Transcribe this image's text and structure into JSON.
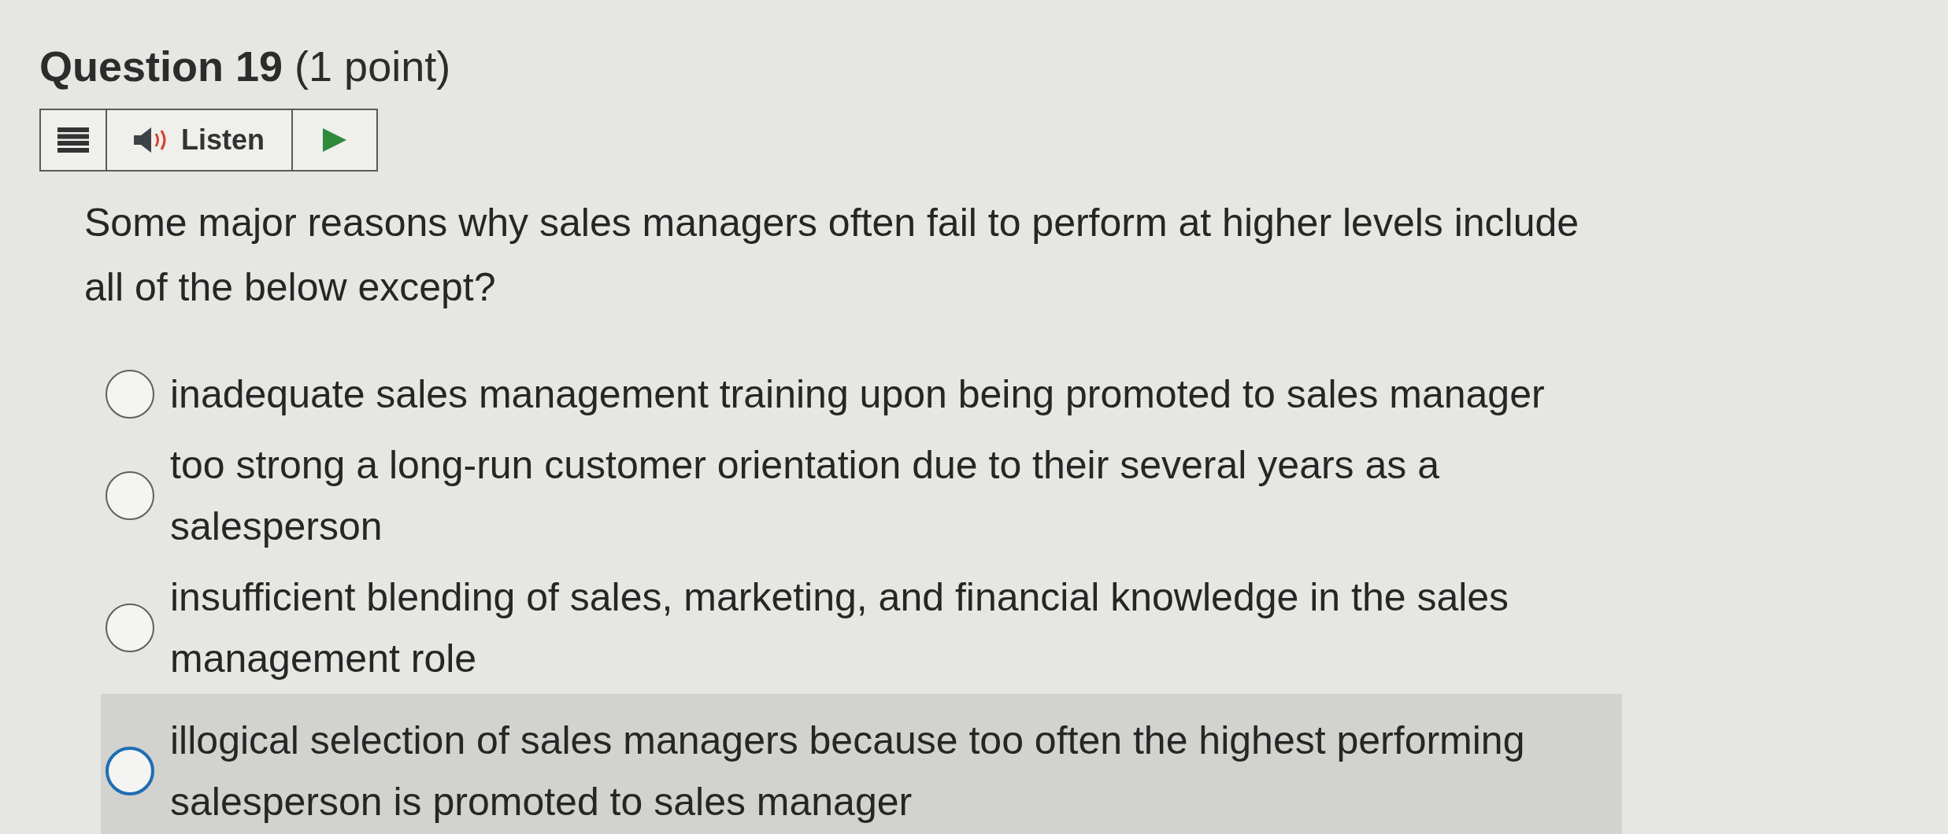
{
  "question": {
    "title": "**Question 19** (1 point)",
    "text": "Some major reasons why sales managers often fail to perform at higher levels include all of the below except?"
  },
  "toolbar": {
    "buttons": [
      {
        "kind": "menu"
      },
      {
        "kind": "listen",
        "label": "Listen"
      },
      {
        "kind": "play"
      }
    ]
  },
  "options": [
    {
      "label": "inadequate sales management training upon being promoted to sales manager",
      "selected": false,
      "highlighted": false
    },
    {
      "label": "too strong a long-run customer orientation due to their several years as a salesperson",
      "selected": false,
      "highlighted": false
    },
    {
      "label": "insufficient blending of sales, marketing, and financial knowledge in the sales management role",
      "selected": false,
      "highlighted": false
    },
    {
      "label": "illogical selection of sales managers because too often the highest performing salesperson is promoted to sales manager",
      "selected": false,
      "highlighted": true
    }
  ]
}
